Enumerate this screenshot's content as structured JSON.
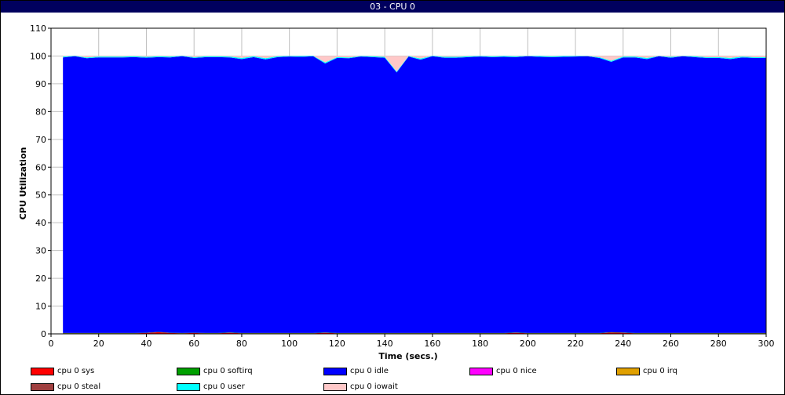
{
  "window_title": "03 - CPU 0",
  "chart_data": {
    "type": "area",
    "stacked": true,
    "title": "03 - CPU 0",
    "xlabel": "Time (secs.)",
    "ylabel": "CPU Utilization",
    "xlim": [
      0,
      300
    ],
    "ylim": [
      0,
      110
    ],
    "xticks": [
      0,
      20,
      40,
      60,
      80,
      100,
      120,
      140,
      160,
      180,
      200,
      220,
      240,
      260,
      280,
      300
    ],
    "yticks": [
      0,
      10,
      20,
      30,
      40,
      50,
      60,
      70,
      80,
      90,
      100,
      110
    ],
    "grid": true,
    "legend_position": "bottom",
    "x": [
      5,
      10,
      15,
      20,
      25,
      30,
      35,
      40,
      45,
      50,
      55,
      60,
      65,
      70,
      75,
      80,
      85,
      90,
      95,
      100,
      105,
      110,
      115,
      120,
      125,
      130,
      135,
      140,
      145,
      150,
      155,
      160,
      165,
      170,
      175,
      180,
      185,
      190,
      195,
      200,
      205,
      210,
      215,
      220,
      225,
      230,
      235,
      240,
      245,
      250,
      255,
      260,
      265,
      270,
      275,
      280,
      285,
      290,
      295,
      300
    ],
    "series": [
      {
        "name": "cpu 0 sys",
        "color": "#ff0000",
        "values": [
          0.2,
          0.2,
          0.2,
          0.2,
          0.2,
          0.2,
          0.2,
          0.3,
          0.6,
          0.3,
          0.2,
          0.3,
          0.2,
          0.2,
          0.4,
          0.2,
          0.2,
          0.2,
          0.2,
          0.2,
          0.2,
          0.2,
          0.4,
          0.2,
          0.2,
          0.2,
          0.2,
          0.2,
          0.2,
          0.2,
          0.2,
          0.2,
          0.2,
          0.2,
          0.2,
          0.2,
          0.2,
          0.2,
          0.4,
          0.2,
          0.2,
          0.2,
          0.2,
          0.2,
          0.2,
          0.2,
          0.5,
          0.4,
          0.2,
          0.2,
          0.2,
          0.2,
          0.2,
          0.2,
          0.2,
          0.2,
          0.2,
          0.2,
          0.2,
          0.2
        ]
      },
      {
        "name": "cpu 0 softirq",
        "color": "#00a000",
        "values": [
          0.1,
          0.1,
          0.1,
          0.1,
          0.1,
          0.1,
          0.1,
          0.1,
          0.1,
          0.1,
          0.1,
          0.1,
          0.1,
          0.1,
          0.1,
          0.1,
          0.1,
          0.1,
          0.1,
          0.1,
          0.1,
          0.1,
          0.1,
          0.1,
          0.1,
          0.1,
          0.1,
          0.1,
          0.1,
          0.1,
          0.1,
          0.1,
          0.1,
          0.1,
          0.1,
          0.1,
          0.1,
          0.1,
          0.1,
          0.1,
          0.1,
          0.1,
          0.1,
          0.1,
          0.1,
          0.1,
          0.1,
          0.1,
          0.1,
          0.1,
          0.1,
          0.1,
          0.1,
          0.1,
          0.1,
          0.1,
          0.1,
          0.1,
          0.1,
          0.1
        ]
      },
      {
        "name": "cpu 0 idle",
        "color": "#0000ff",
        "values": [
          99.2,
          99.6,
          98.9,
          99.2,
          99.2,
          99.2,
          99.3,
          99.0,
          98.9,
          99.1,
          99.6,
          98.9,
          99.3,
          99.3,
          99.0,
          98.6,
          99.3,
          98.5,
          99.3,
          99.5,
          99.4,
          99.6,
          96.8,
          99.0,
          98.9,
          99.5,
          99.3,
          99.1,
          93.8,
          99.5,
          98.4,
          99.6,
          99.1,
          99.1,
          99.3,
          99.5,
          99.3,
          99.4,
          99.1,
          99.6,
          99.4,
          99.3,
          99.4,
          99.5,
          99.6,
          99.0,
          97.3,
          99.0,
          99.2,
          98.6,
          99.6,
          99.1,
          99.6,
          99.3,
          99.0,
          99.0,
          98.6,
          99.2,
          99.0,
          99.0
        ]
      },
      {
        "name": "cpu 0 nice",
        "color": "#ff00ff",
        "values": [
          0,
          0,
          0,
          0,
          0,
          0,
          0,
          0,
          0,
          0,
          0,
          0,
          0,
          0,
          0,
          0,
          0,
          0,
          0,
          0,
          0,
          0,
          0,
          0,
          0,
          0,
          0,
          0,
          0,
          0,
          0,
          0,
          0,
          0,
          0,
          0,
          0,
          0,
          0,
          0,
          0,
          0,
          0,
          0,
          0,
          0,
          0,
          0,
          0,
          0,
          0,
          0,
          0,
          0,
          0,
          0,
          0,
          0,
          0,
          0
        ]
      },
      {
        "name": "cpu 0 irq",
        "color": "#e0a000",
        "values": [
          0,
          0,
          0,
          0,
          0,
          0,
          0,
          0,
          0,
          0,
          0,
          0,
          0,
          0,
          0,
          0,
          0,
          0,
          0,
          0,
          0,
          0,
          0,
          0,
          0,
          0,
          0,
          0,
          0,
          0,
          0,
          0,
          0,
          0,
          0,
          0,
          0,
          0,
          0,
          0,
          0,
          0,
          0,
          0,
          0,
          0,
          0,
          0,
          0,
          0,
          0,
          0,
          0,
          0,
          0,
          0,
          0,
          0,
          0,
          0
        ]
      },
      {
        "name": "cpu 0 steal",
        "color": "#a04040",
        "values": [
          0,
          0,
          0,
          0,
          0,
          0,
          0,
          0,
          0,
          0,
          0,
          0,
          0,
          0,
          0,
          0,
          0,
          0,
          0,
          0,
          0,
          0,
          0,
          0,
          0,
          0,
          0,
          0,
          0,
          0,
          0,
          0,
          0,
          0,
          0,
          0,
          0,
          0,
          0,
          0,
          0,
          0,
          0,
          0,
          0,
          0,
          0,
          0,
          0,
          0,
          0,
          0,
          0,
          0,
          0,
          0,
          0,
          0,
          0,
          0
        ]
      },
      {
        "name": "cpu 0 user",
        "color": "#00ffff",
        "values": [
          0.3,
          0.2,
          0.3,
          0.3,
          0.3,
          0.3,
          0.3,
          0.3,
          0.3,
          0.3,
          0.2,
          0.3,
          0.3,
          0.3,
          0.3,
          0.4,
          0.3,
          0.4,
          0.3,
          0.2,
          0.3,
          0.2,
          0.4,
          0.3,
          0.3,
          0.2,
          0.3,
          0.3,
          0.3,
          0.2,
          0.4,
          0.2,
          0.3,
          0.3,
          0.3,
          0.2,
          0.3,
          0.3,
          0.3,
          0.1,
          0.3,
          0.3,
          0.3,
          0.2,
          0.1,
          0.3,
          0.4,
          0.3,
          0.3,
          0.4,
          0.1,
          0.3,
          0.1,
          0.3,
          0.3,
          0.3,
          0.4,
          0.3,
          0.3,
          0.3
        ]
      },
      {
        "name": "cpu 0 iowait",
        "color": "#ffc8c8",
        "values": [
          0.2,
          0.1,
          0.5,
          0.2,
          0.2,
          0.2,
          0.1,
          0.3,
          0.1,
          0.2,
          0.1,
          0.4,
          0.1,
          0.1,
          0.2,
          0.7,
          0.1,
          0.8,
          0.1,
          0.0,
          0.0,
          0.0,
          2.3,
          0.4,
          0.5,
          0.0,
          0.1,
          0.3,
          5.6,
          0.0,
          0.9,
          0.0,
          0.3,
          0.3,
          0.1,
          0.0,
          0.1,
          0.0,
          0.1,
          0.0,
          0.0,
          0.1,
          0.0,
          0.0,
          0.0,
          0.4,
          1.7,
          0.2,
          0.2,
          0.7,
          0.0,
          0.3,
          0.0,
          0.1,
          0.4,
          0.4,
          0.7,
          0.2,
          0.4,
          0.4
        ]
      }
    ]
  }
}
